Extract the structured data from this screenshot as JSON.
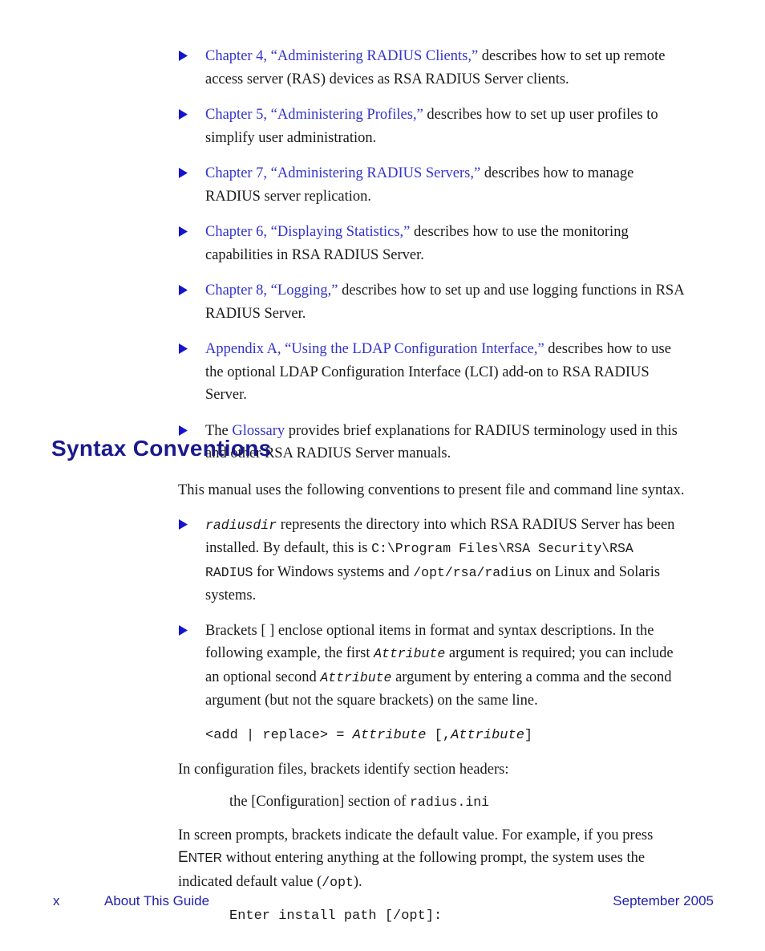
{
  "document": {
    "page_number": "x",
    "footer_section": "About This Guide",
    "footer_date": "September 2005"
  },
  "intro_bullets": [
    {
      "link": "Chapter 4, “Administering RADIUS Clients,”",
      "text": " describes how to set up remote access server (RAS) devices as RSA RADIUS Server clients."
    },
    {
      "link": "Chapter 5, “Administering Profiles,”",
      "text": " describes how to set up user profiles to simplify user administration."
    },
    {
      "link": "Chapter 7, “Administering RADIUS Servers,”",
      "text": " describes how to manage RADIUS server replication."
    },
    {
      "link": "Chapter 6, “Displaying Statistics,”",
      "text": " describes how to use the monitoring capabilities in RSA RADIUS Server."
    },
    {
      "link": "Chapter 8, “Logging,”",
      "text": " describes how to set up and use logging functions in RSA RADIUS Server."
    },
    {
      "link": "Appendix A, “Using the LDAP Configuration Interface,”",
      "text": " describes how to use the optional LDAP Configuration Interface (LCI) add-on to RSA RADIUS Server."
    },
    {
      "prefix": "The ",
      "link": "Glossary",
      "text": " provides brief explanations for RADIUS terminology used in this and other RSA RADIUS Server manuals."
    }
  ],
  "section": {
    "heading": "Syntax Conventions",
    "intro": "This manual uses the following conventions to present file and command line syntax.",
    "bullet_radiusdir": {
      "term": "radiusdir",
      "part1": " represents the directory into which RSA RADIUS Server has been installed. By default, this is ",
      "code1": "C:\\Program Files\\RSA Security\\RSA RADIUS",
      "part2": " for Windows systems and ",
      "code2": "/opt/rsa/radius",
      "part3": " on Linux and Solaris systems."
    },
    "bullet_brackets": {
      "part1": "Brackets [ ] enclose optional items in format and syntax descriptions. In the following example, the first ",
      "term1": "Attribute",
      "part2": " argument is required; you can include an optional second ",
      "term2": "Attribute",
      "part3": " argument by entering a comma and the second argument (but not the square brackets) on the same line."
    },
    "code_example_1": {
      "roman1": "<add | replace> = ",
      "italic1": "Attribute",
      "roman2": " [,",
      "italic2": "Attribute",
      "roman3": "]"
    },
    "para_config": "In configuration files, brackets identify section headers:",
    "config_example": {
      "text": "the [Configuration] section of ",
      "code": "radius.ini"
    },
    "para_prompts": {
      "part1": "In screen prompts, brackets indicate the default value. For example, if you press ",
      "key_cap": "E",
      "key_rest": "NTER",
      "part2": " without entering anything at the following prompt, the system uses the indicated default value (",
      "code": "/opt",
      "part3": ")."
    },
    "code_example_2": "Enter install path [/opt]:"
  },
  "colors": {
    "link": "#3333cc",
    "heading": "#1a1a8c",
    "footer": "#2222aa",
    "body": "#1a1a1a"
  }
}
